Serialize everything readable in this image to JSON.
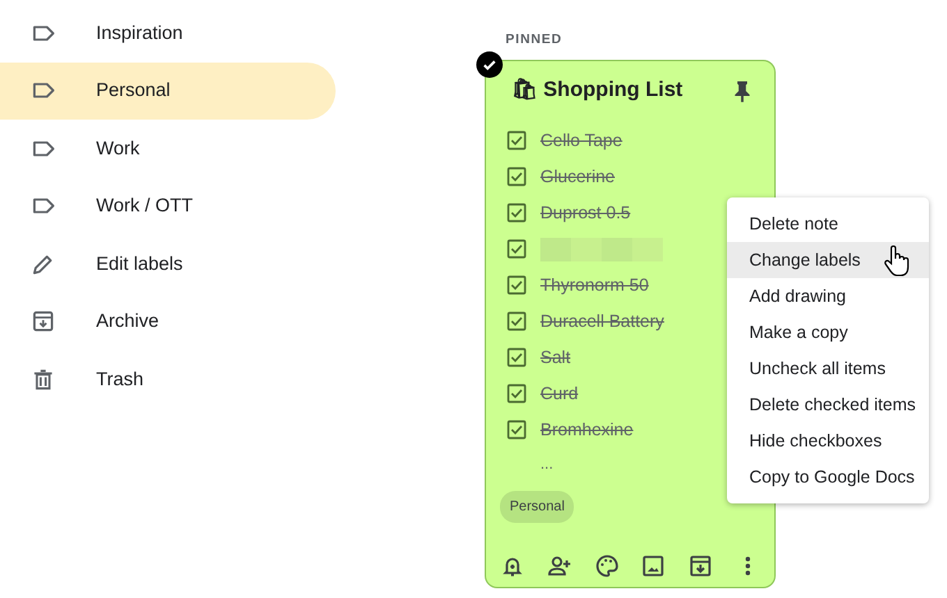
{
  "sidebar": {
    "items": [
      {
        "label": "Inspiration",
        "kind": "label",
        "selected": false
      },
      {
        "label": "Personal",
        "kind": "label",
        "selected": true
      },
      {
        "label": "Work",
        "kind": "label",
        "selected": false
      },
      {
        "label": "Work / OTT",
        "kind": "label",
        "selected": false
      },
      {
        "label": "Edit labels",
        "kind": "edit",
        "selected": false
      },
      {
        "label": "Archive",
        "kind": "archive",
        "selected": false
      },
      {
        "label": "Trash",
        "kind": "trash",
        "selected": false
      }
    ]
  },
  "section_heading": "PINNED",
  "note": {
    "title": "🛍 Shopping List",
    "note_selected": true,
    "pinned": true,
    "items": [
      {
        "kind": "text",
        "text": "Cello Tape",
        "checked": true
      },
      {
        "kind": "text",
        "text": "Glucerine",
        "checked": true
      },
      {
        "kind": "text",
        "text": "Duprost 0.5",
        "checked": true
      },
      {
        "kind": "blurred",
        "checked": true
      },
      {
        "kind": "text",
        "text": "Thyronorm 50",
        "checked": true
      },
      {
        "kind": "text",
        "text": "Duracell Battery",
        "checked": true
      },
      {
        "kind": "text",
        "text": "Salt",
        "checked": true
      },
      {
        "kind": "text",
        "text": "Curd",
        "checked": true
      },
      {
        "kind": "text",
        "text": "Bromhexine",
        "checked": true
      }
    ],
    "more": "...",
    "label_chip": "Personal"
  },
  "menu": {
    "items": [
      {
        "label": "Delete note",
        "selected": false
      },
      {
        "label": "Change labels",
        "selected": true
      },
      {
        "label": "Add drawing",
        "selected": false
      },
      {
        "label": "Make a copy",
        "selected": false
      },
      {
        "label": "Uncheck all items",
        "selected": false
      },
      {
        "label": "Delete checked items",
        "selected": false
      },
      {
        "label": "Hide checkboxes",
        "selected": false
      },
      {
        "label": "Copy to Google Docs",
        "selected": false
      }
    ]
  }
}
